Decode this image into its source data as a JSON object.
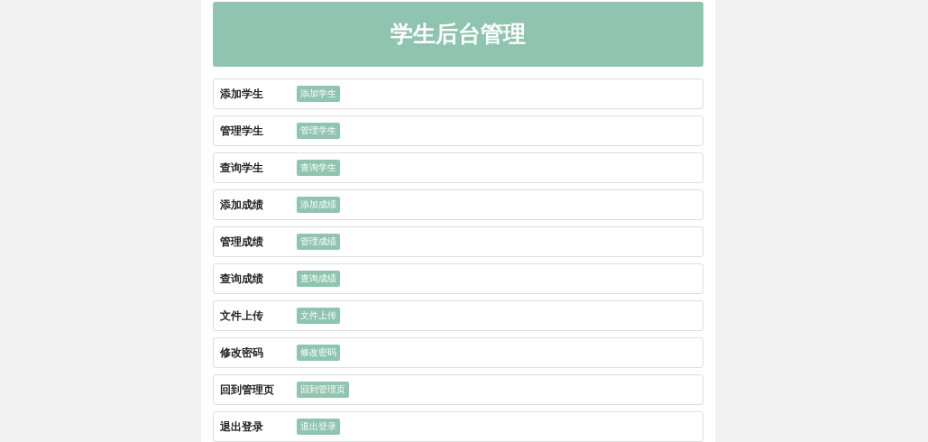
{
  "header": {
    "title": "学生后台管理"
  },
  "rows": [
    {
      "label": "添加学生",
      "button": "添加学生"
    },
    {
      "label": "管理学生",
      "button": "管理学生"
    },
    {
      "label": "查询学生",
      "button": "查询学生"
    },
    {
      "label": "添加成绩",
      "button": "添加成绩"
    },
    {
      "label": "管理成绩",
      "button": "管理成绩"
    },
    {
      "label": "查询成绩",
      "button": "查询成绩"
    },
    {
      "label": "文件上传",
      "button": "文件上传"
    },
    {
      "label": "修改密码",
      "button": "修改密码"
    },
    {
      "label": "回到管理页",
      "button": "回到管理页"
    },
    {
      "label": "退出登录",
      "button": "退出登录"
    }
  ]
}
